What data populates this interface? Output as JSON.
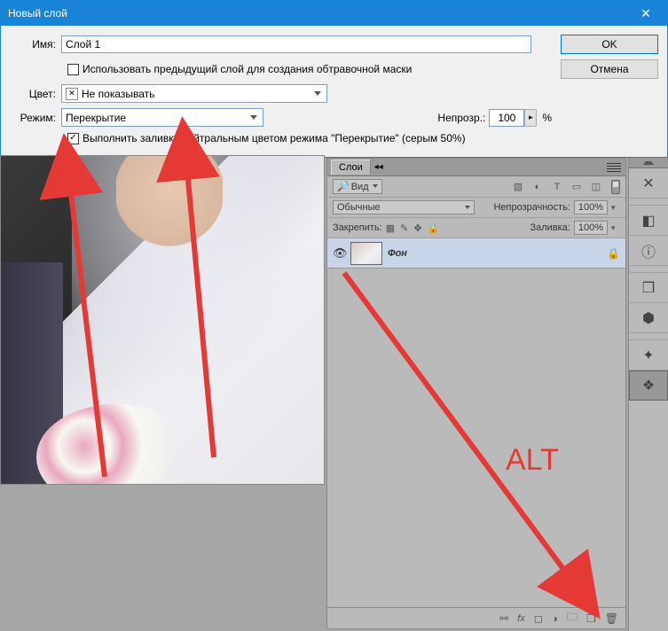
{
  "dialog": {
    "title": "Новый слой",
    "name_label": "Имя:",
    "name_value": "Слой 1",
    "ok": "OK",
    "cancel": "Отмена",
    "clip_check": "Использовать предыдущий слой для создания обтравочной маски",
    "color_label": "Цвет:",
    "color_value": "Не показывать",
    "mode_label": "Режим:",
    "mode_value": "Перекрытие",
    "opacity_label": "Непрозр.:",
    "opacity_value": "100",
    "opacity_unit": "%",
    "fill_check": "Выполнить заливку нейтральным цветом режима \"Перекрытие\"  (серым 50%)"
  },
  "layers": {
    "tab": "Слои",
    "kind": "Вид",
    "blend": "Обычные",
    "opacity_label": "Непрозрачность:",
    "opacity": "100%",
    "lock_label": "Закрепить:",
    "fill_label": "Заливка:",
    "fill": "100%",
    "layer0": "Фон"
  },
  "annotation": {
    "alt": "ALT"
  }
}
